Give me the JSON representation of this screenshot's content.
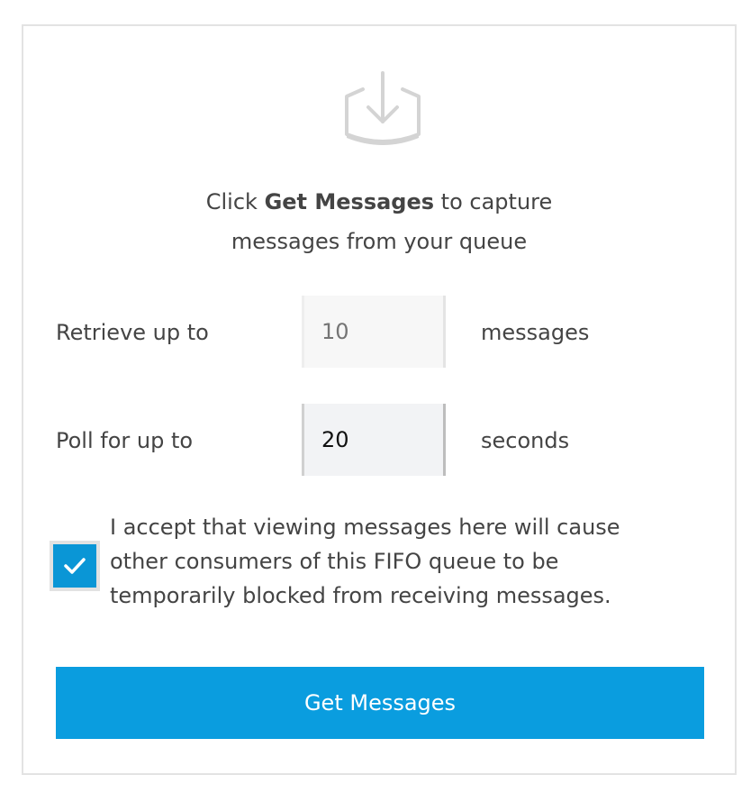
{
  "intro": {
    "prefix": "Click ",
    "bold": "Get Messages",
    "suffix": " to capture",
    "line2": "messages from your queue"
  },
  "retrieve": {
    "label": "Retrieve up to",
    "placeholder": "10",
    "value": "",
    "unit": "messages"
  },
  "poll": {
    "label": "Poll for up to",
    "value": "20",
    "unit": "seconds"
  },
  "acknowledge": {
    "checked": true,
    "line1": "I accept that viewing messages here will cause",
    "line2": "other consumers of this FIFO queue to be",
    "line3": "temporarily blocked from receiving messages."
  },
  "button": {
    "label": "Get Messages"
  },
  "colors": {
    "accent": "#0a9ddf",
    "checkbox": "#0a96d6",
    "text": "#444444",
    "icon": "#d4d4d4"
  },
  "icons": {
    "tray": "download-tray-icon",
    "check": "checkmark-icon"
  }
}
